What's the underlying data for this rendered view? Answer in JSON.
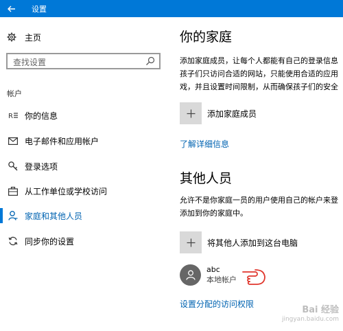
{
  "window": {
    "title": "设置",
    "back_icon": "back-arrow-icon"
  },
  "sidebar": {
    "home_label": "主页",
    "search_placeholder": "查找设置",
    "section_label": "帐户",
    "items": [
      {
        "label": "你的信息",
        "icon": "contact-card-icon",
        "active": false
      },
      {
        "label": "电子邮件和应用帐户",
        "icon": "mail-icon",
        "active": false
      },
      {
        "label": "登录选项",
        "icon": "key-icon",
        "active": false
      },
      {
        "label": "从工作单位或学校访问",
        "icon": "briefcase-icon",
        "active": false
      },
      {
        "label": "家庭和其他人员",
        "icon": "person-icon",
        "active": true
      },
      {
        "label": "同步你的设置",
        "icon": "sync-icon",
        "active": false
      }
    ]
  },
  "main": {
    "family": {
      "title": "你的家庭",
      "description_lines": [
        "添加家庭成员，让每个人都能有自己的登录信息",
        "孩子们只访问合适的网站，只能使用合适的应用",
        "戏，并且设置时间限制，从而确保孩子们的安全"
      ],
      "add_label": "添加家庭成员",
      "learn_more": "了解详细信息"
    },
    "others": {
      "title": "其他人员",
      "description_lines": [
        "允许不是你家庭一员的用户使用自己的帐户来登",
        "添加到你的家庭中。"
      ],
      "add_label": "将其他人添加到这台电脑",
      "user": {
        "name": "abc",
        "type": "本地帐户"
      },
      "assigned_access": "设置分配的访问权限"
    }
  },
  "watermark": {
    "line1": "Bai 经验",
    "line2": "jingyan.baidu.com"
  },
  "colors": {
    "accent": "#0078d7",
    "link": "#0063b1",
    "pointer": "#e0362c"
  }
}
